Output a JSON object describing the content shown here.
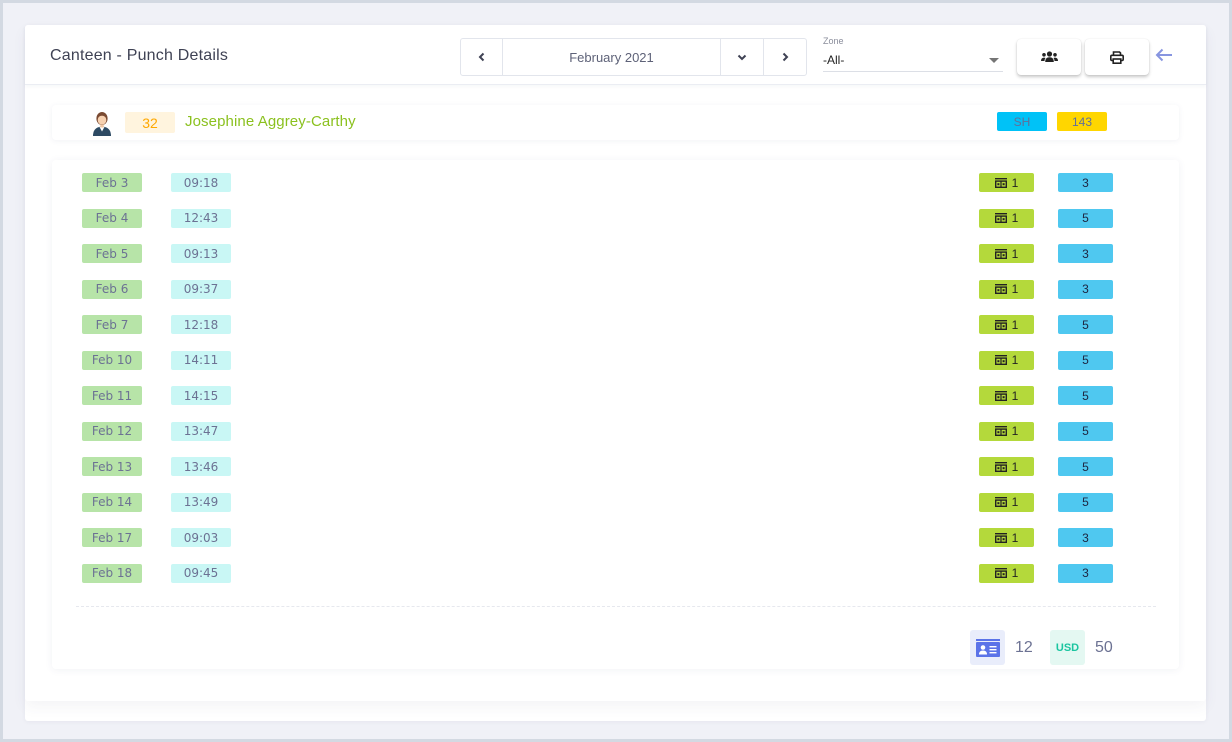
{
  "header": {
    "title": "Canteen - Punch Details",
    "month": "February 2021",
    "zone_label": "Zone",
    "zone_value": "-All-",
    "icons": {
      "prev": "chevron-left-icon",
      "down": "chevron-down-icon",
      "next": "chevron-right-icon",
      "users": "users-icon",
      "print": "print-icon",
      "back": "arrow-left-icon"
    }
  },
  "employee": {
    "id": "32",
    "name": "Josephine Aggrey-Carthy",
    "shift": "SH",
    "count": "143"
  },
  "punches": [
    {
      "date": "Feb 3",
      "time": "09:18",
      "meals": "1",
      "qty": "3"
    },
    {
      "date": "Feb 4",
      "time": "12:43",
      "meals": "1",
      "qty": "5"
    },
    {
      "date": "Feb 5",
      "time": "09:13",
      "meals": "1",
      "qty": "3"
    },
    {
      "date": "Feb 6",
      "time": "09:37",
      "meals": "1",
      "qty": "3"
    },
    {
      "date": "Feb 7",
      "time": "12:18",
      "meals": "1",
      "qty": "5"
    },
    {
      "date": "Feb 10",
      "time": "14:11",
      "meals": "1",
      "qty": "5"
    },
    {
      "date": "Feb 11",
      "time": "14:15",
      "meals": "1",
      "qty": "5"
    },
    {
      "date": "Feb 12",
      "time": "13:47",
      "meals": "1",
      "qty": "5"
    },
    {
      "date": "Feb 13",
      "time": "13:46",
      "meals": "1",
      "qty": "5"
    },
    {
      "date": "Feb 14",
      "time": "13:49",
      "meals": "1",
      "qty": "5"
    },
    {
      "date": "Feb 17",
      "time": "09:03",
      "meals": "1",
      "qty": "3"
    },
    {
      "date": "Feb 18",
      "time": "09:45",
      "meals": "1",
      "qty": "3"
    }
  ],
  "summary": {
    "card_count": "12",
    "currency": "USD",
    "amount": "50"
  },
  "colors": {
    "name_green": "#8bc11f",
    "id_orange": "#ffa800",
    "shift_blue": "#00c2f7",
    "count_yellow": "#ffd600",
    "date_green": "#b7e4a8",
    "time_cyan": "#c9f7f5",
    "meal_lime": "#b4d93b",
    "qty_blue": "#4fc8f0",
    "back_arrow": "#8795e0"
  }
}
